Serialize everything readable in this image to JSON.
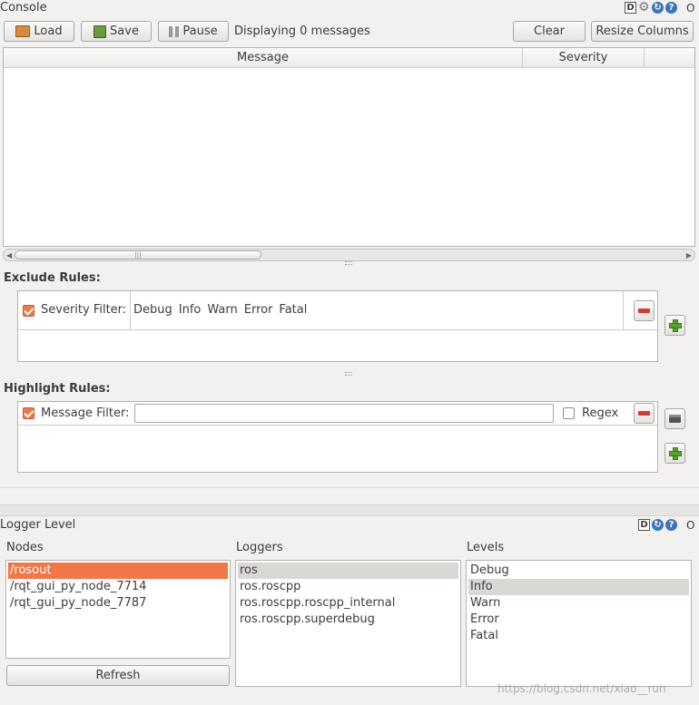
{
  "console": {
    "title": "Console",
    "corner_labels": {
      "d": "D",
      "o": "O",
      "help": "?"
    },
    "toolbar": {
      "load_label": "Load",
      "save_label": "Save",
      "pause_label": "Pause",
      "status_text": "Displaying 0 messages",
      "clear_label": "Clear",
      "resize_label": "Resize Columns"
    },
    "table": {
      "columns": [
        "Message",
        "Severity"
      ]
    },
    "scroll_grip": "|||"
  },
  "exclude_rules": {
    "heading": "Exclude Rules:",
    "severity_filter_label": "Severity Filter:",
    "severities": [
      "Debug",
      "Info",
      "Warn",
      "Error",
      "Fatal"
    ]
  },
  "highlight_rules": {
    "heading": "Highlight Rules:",
    "message_filter_label": "Message Filter:",
    "message_filter_value": "",
    "regex_label": "Regex"
  },
  "logger_level": {
    "title": "Logger Level",
    "corner_labels": {
      "d": "D",
      "o": "O",
      "help": "?"
    },
    "nodes": {
      "heading": "Nodes",
      "items": [
        "/rosout",
        "/rqt_gui_py_node_7714",
        "/rqt_gui_py_node_7787"
      ],
      "selected_index": 0,
      "refresh_label": "Refresh"
    },
    "loggers": {
      "heading": "Loggers",
      "items": [
        "ros",
        "ros.roscpp",
        "ros.roscpp.roscpp_internal",
        "ros.roscpp.superdebug"
      ],
      "selected_index": 0
    },
    "levels": {
      "heading": "Levels",
      "items": [
        "Debug",
        "Info",
        "Warn",
        "Error",
        "Fatal"
      ],
      "selected_index": 1
    }
  },
  "watermark": "https://blog.csdn.net/xiao__run",
  "colors": {
    "selection_orange": "#f07746",
    "selection_gray": "#dad8d5",
    "help_blue": "#3b73b9"
  }
}
